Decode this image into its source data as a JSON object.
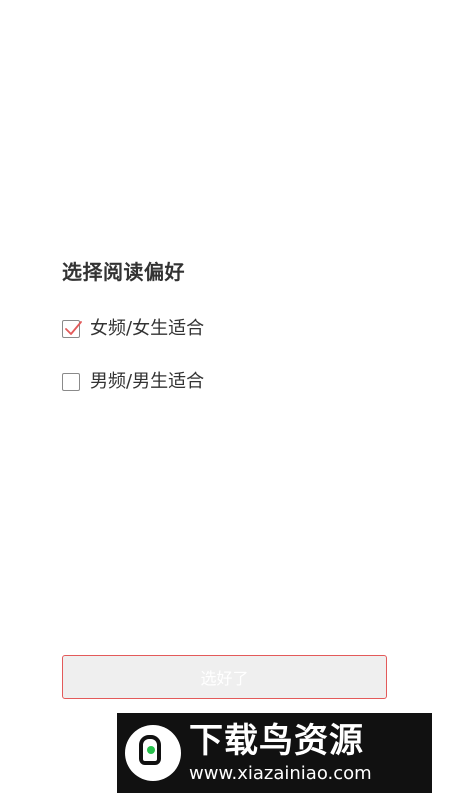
{
  "page": {
    "title": "选择阅读偏好"
  },
  "options": [
    {
      "label": "女频/女生适合",
      "checked": true
    },
    {
      "label": "男频/男生适合",
      "checked": false
    }
  ],
  "confirm": {
    "label": "选好了"
  },
  "watermark": {
    "name": "下载鸟资源",
    "url": "www.xiazainiao.com"
  },
  "colors": {
    "accent": "#e35a5a",
    "text": "#333333",
    "button_bg": "#efefef",
    "watermark_bg": "#111111",
    "logo_dot": "#27c24c"
  }
}
